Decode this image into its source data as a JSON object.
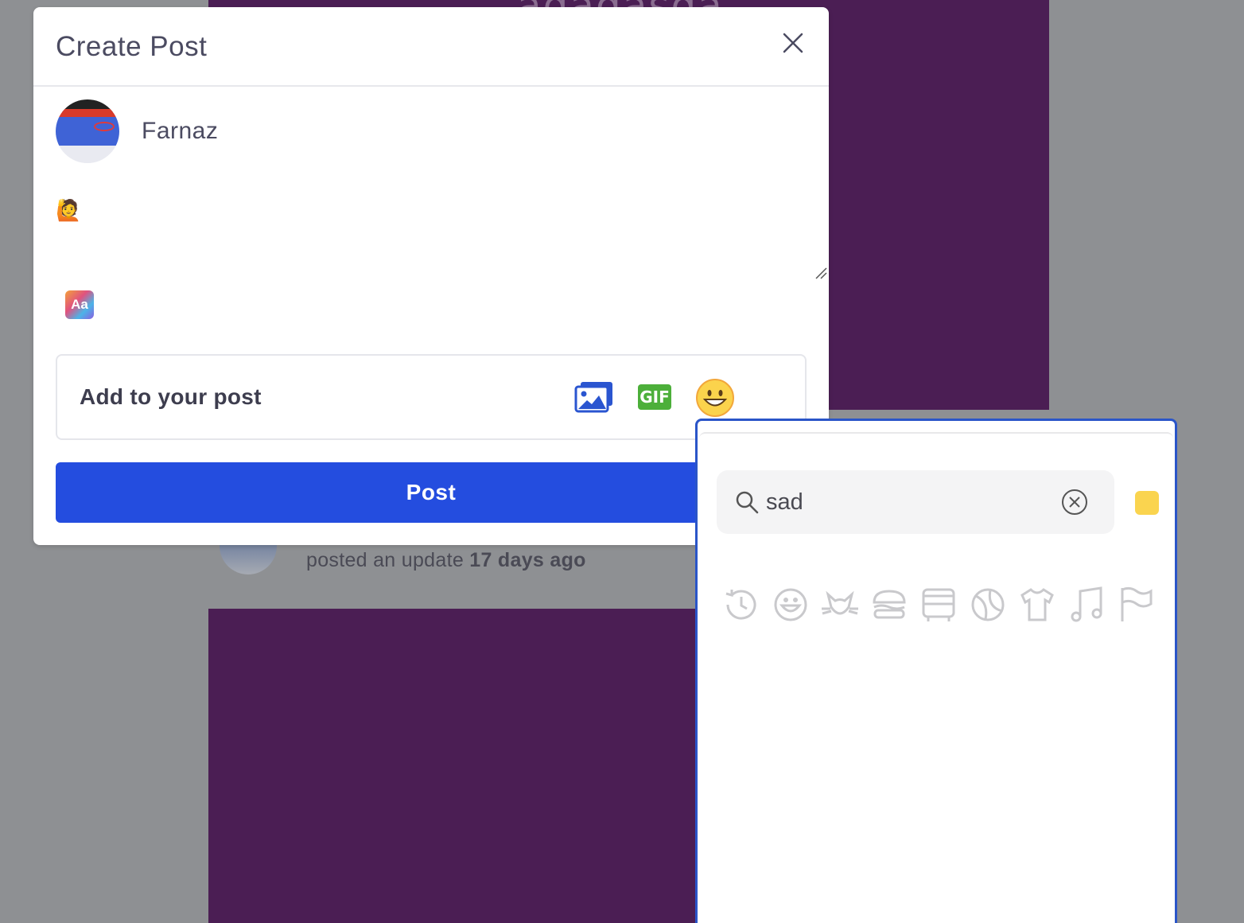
{
  "background": {
    "partial_heading": "adadasda",
    "update_action": "posted an update",
    "update_time": "17 days ago"
  },
  "modal": {
    "title": "Create Post",
    "username": "Farnaz",
    "post_content": "🙋",
    "font_button_label": "Aa",
    "add_to_post_label": "Add to your post",
    "gif_label": "GIF",
    "post_button_label": "Post"
  },
  "emoji_picker": {
    "search_value": "sad",
    "skin_tone_color": "#fad44f",
    "categories": [
      "clock-icon",
      "smiley-icon",
      "cat-icon",
      "burger-icon",
      "bus-icon",
      "ball-icon",
      "shirt-icon",
      "music-note-icon",
      "flag-icon"
    ]
  },
  "colors": {
    "accent": "#244ddf",
    "background_purple": "#4b1e54",
    "gif_green": "#4caf3a",
    "picker_border": "#2a55c8"
  }
}
